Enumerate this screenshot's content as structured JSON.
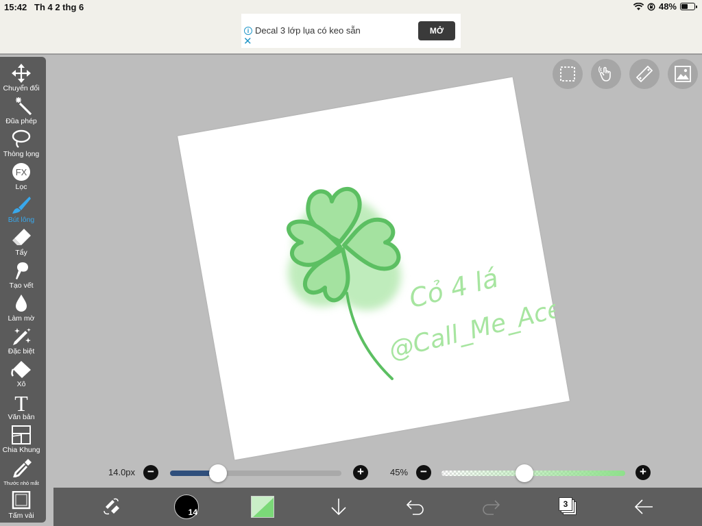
{
  "status": {
    "time": "15:42",
    "date": "Th 4 2 thg 6",
    "battery": "48%",
    "battery_level": 0.48
  },
  "ad": {
    "text": "Decal 3 lớp lụa có keo sẵn",
    "cta": "MỞ",
    "info_glyph": "i",
    "close_glyph": "✕"
  },
  "tools": [
    {
      "id": "transform",
      "label": "Chuyển đổi",
      "icon": "move-arrows-icon"
    },
    {
      "id": "magic-wand",
      "label": "Đũa phép",
      "icon": "magic-wand-icon"
    },
    {
      "id": "lasso",
      "label": "Thòng lọng",
      "icon": "lasso-icon"
    },
    {
      "id": "filter",
      "label": "Lọc",
      "icon": "fx-icon",
      "glyph": "FX"
    },
    {
      "id": "brush",
      "label": "Bút lông",
      "icon": "brush-icon",
      "active": true
    },
    {
      "id": "eraser",
      "label": "Tẩy",
      "icon": "eraser-icon"
    },
    {
      "id": "smudge",
      "label": "Tạo vết",
      "icon": "smudge-icon"
    },
    {
      "id": "blur",
      "label": "Làm mờ",
      "icon": "blur-drop-icon"
    },
    {
      "id": "special",
      "label": "Đặc biệt",
      "icon": "sparkle-pen-icon"
    },
    {
      "id": "fill",
      "label": "Xô",
      "icon": "bucket-icon"
    },
    {
      "id": "text",
      "label": "Văn bản",
      "icon": "text-icon",
      "glyph": "T"
    },
    {
      "id": "frame",
      "label": "Chia Khung",
      "icon": "frame-divider-icon"
    },
    {
      "id": "eyedropper",
      "label": "Thước nhỏ mắt",
      "icon": "eyedropper-icon"
    },
    {
      "id": "canvas",
      "label": "Tấm vải",
      "icon": "canvas-icon"
    }
  ],
  "top_buttons": [
    "selection-icon",
    "hand-gesture-icon",
    "ruler-icon",
    "image-reference-icon"
  ],
  "artwork": {
    "caption_line1": "Cỏ 4 lá",
    "caption_line2": "@Call_Me_Ace"
  },
  "brush_size": {
    "label": "14.0px",
    "value_fraction": 0.28
  },
  "opacity": {
    "label": "45%",
    "value_fraction": 0.45
  },
  "bottom": {
    "brush_size_badge": "14",
    "layer_count": "3"
  },
  "colors": {
    "toolbar": "#5b5b5b",
    "accent": "#39a8ec",
    "primary_color": "#8ee08b",
    "canvas_bg": "#bdbdbd"
  }
}
